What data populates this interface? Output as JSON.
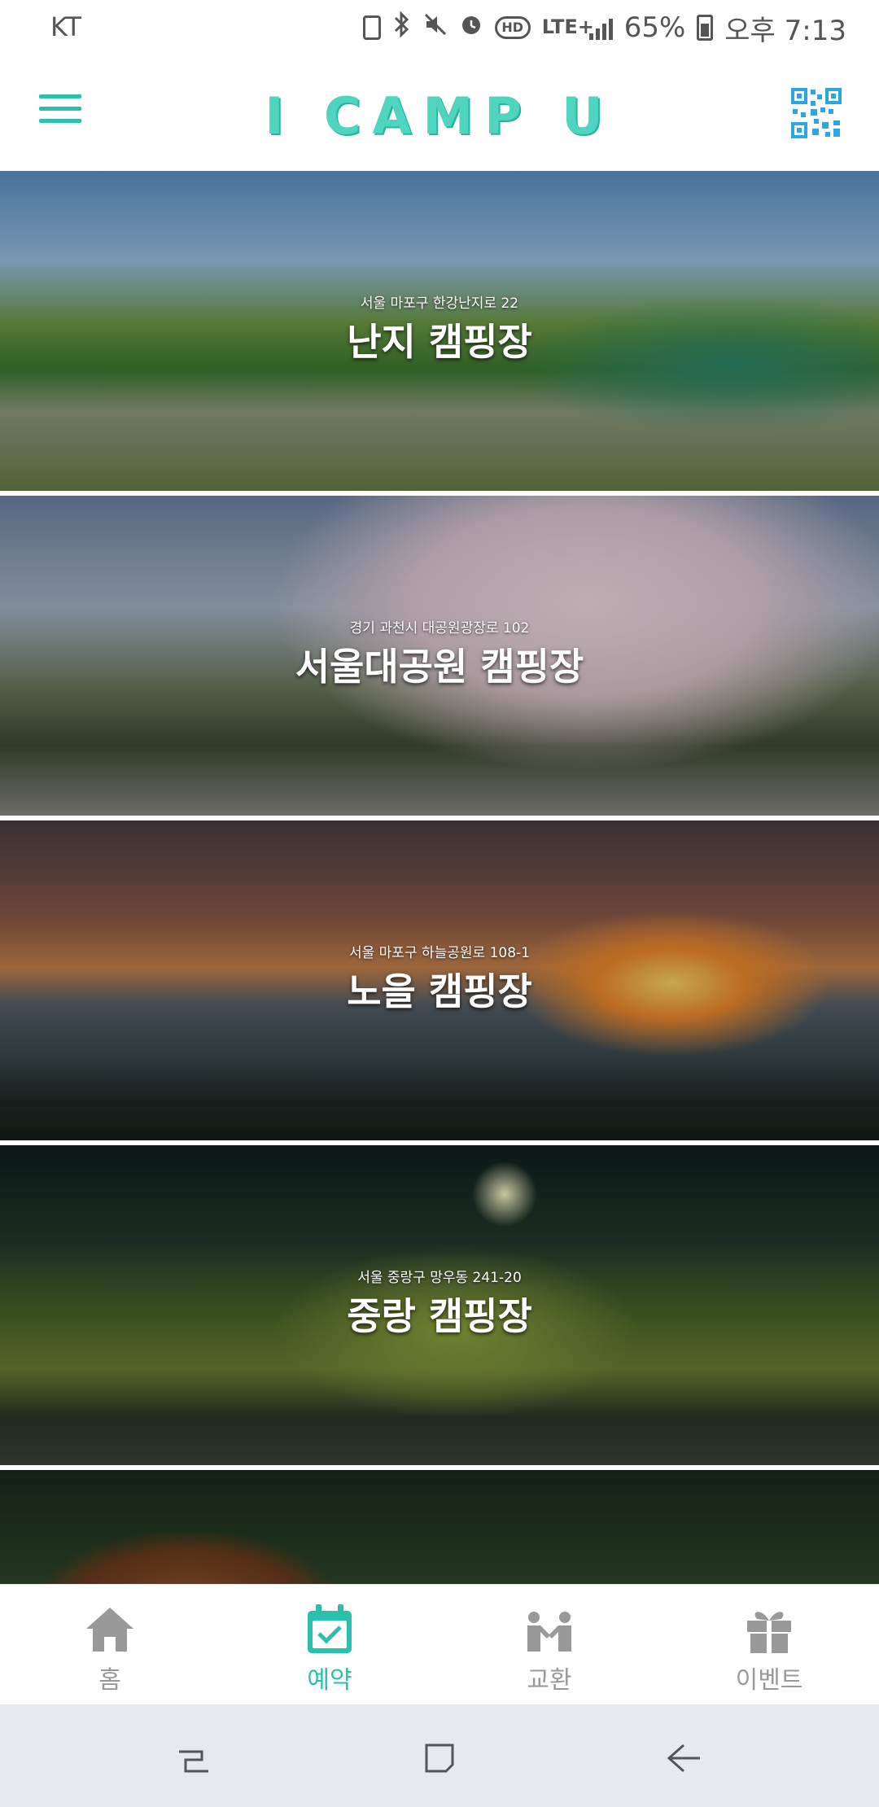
{
  "status_bar": {
    "carrier": "KT",
    "battery": "65%",
    "time": "오후 7:13",
    "network": "LTE+"
  },
  "header": {
    "title": "I CAMP U",
    "menu_icon": "hamburger-menu-icon",
    "qr_icon": "qr-code-icon",
    "accent_color": "#2bbfae"
  },
  "camps": [
    {
      "address": "서울 마포구 한강난지로 22",
      "name": "난지 캠핑장"
    },
    {
      "address": "경기 과천시 대공원광장로 102",
      "name": "서울대공원 캠핑장"
    },
    {
      "address": "서울 마포구 하늘공원로 108-1",
      "name": "노을 캠핑장"
    },
    {
      "address": "서울 중랑구 망우동 241-20",
      "name": "중랑 캠핑장"
    },
    {
      "address": "",
      "name": ""
    }
  ],
  "bottom_nav": [
    {
      "label": "홈",
      "icon": "home-icon",
      "active": false
    },
    {
      "label": "예약",
      "icon": "calendar-check-icon",
      "active": true
    },
    {
      "label": "교환",
      "icon": "handshake-icon",
      "active": false
    },
    {
      "label": "이벤트",
      "icon": "gift-icon",
      "active": false
    }
  ],
  "system_nav": {
    "recents_icon": "recents-icon",
    "home_icon": "home-square-icon",
    "back_icon": "back-arrow-icon"
  }
}
